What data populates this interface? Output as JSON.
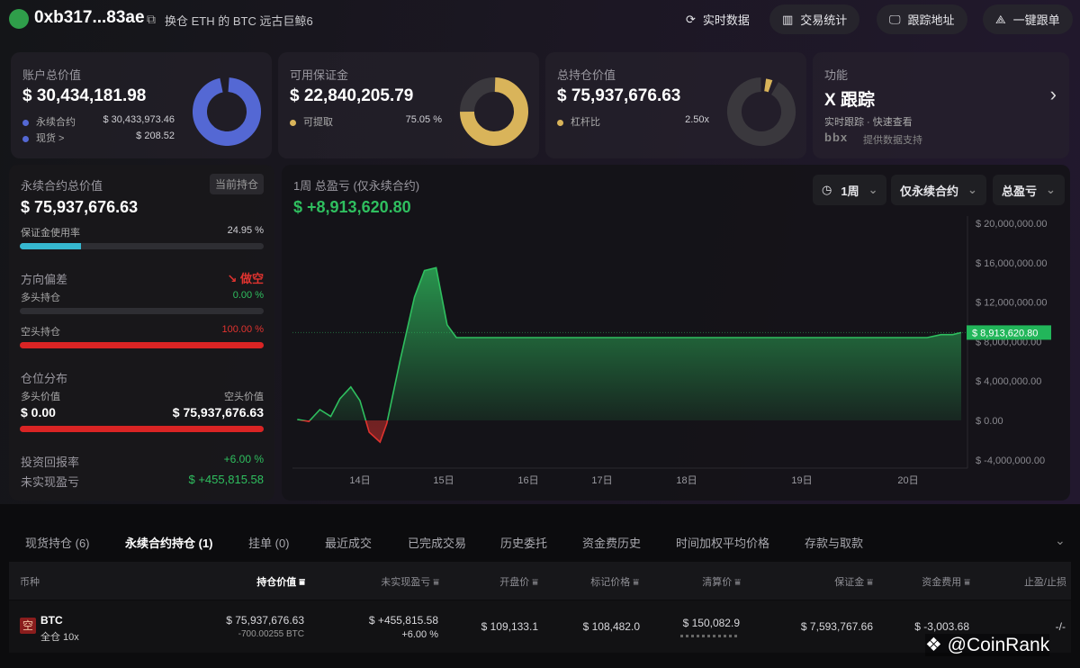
{
  "header": {
    "address": "0xb317...83ae",
    "label": "换仓 ETH 的 BTC 远古巨鲸6",
    "buttons": [
      "实时数据",
      "交易统计",
      "跟踪地址",
      "一键跟单"
    ]
  },
  "cards": {
    "account": {
      "title": "账户总价值",
      "value": "$ 30,434,181.98",
      "rows": [
        {
          "label": "永续合约",
          "value": "$ 30,433,973.46"
        },
        {
          "label": "现货 >",
          "value": "$ 208.52"
        }
      ],
      "color": "#5468d4"
    },
    "margin": {
      "title": "可用保证金",
      "value": "$ 22,840,205.79",
      "row_label": "可提取",
      "row_value": "75.05 %",
      "percent": 75.05,
      "color": "#d9b45a"
    },
    "position": {
      "title": "总持仓价值",
      "value": "$ 75,937,676.63",
      "row_label": "杠杆比",
      "row_value": "2.50x",
      "color": "#d9b45a"
    },
    "feature": {
      "title": "功能",
      "name": "X 跟踪",
      "desc": "实时跟踪 · 快速查看",
      "brand": "bbx",
      "support": "提供数据支持"
    }
  },
  "perp": {
    "title": "永续合约总价值",
    "badge": "当前持仓",
    "value": "$ 75,937,676.63",
    "margin_label": "保证金使用率",
    "margin_value": "24.95 %",
    "margin_percent": 24.95,
    "direction_label": "方向偏差",
    "direction_value": "做空",
    "long_label": "多头持仓",
    "long_value": "0.00 %",
    "short_label": "空头持仓",
    "short_value": "100.00 %",
    "dist_label": "仓位分布",
    "long_val_label": "多头价值",
    "short_val_label": "空头价值",
    "long_val": "$ 0.00",
    "short_val": "$ 75,937,676.63",
    "roi_label": "投资回报率",
    "roi_value": "+6.00 %",
    "upnl_label": "未实现盈亏",
    "upnl_value": "$ +455,815.58"
  },
  "chart": {
    "title": "1周 总盈亏 (仅永续合约)",
    "value": "$ +8,913,620.80",
    "filters": [
      "1周",
      "仅永续合约",
      "总盈亏"
    ],
    "current_label": "$ 8,913,620.80"
  },
  "chart_data": {
    "type": "area",
    "ylim": [
      -4000000,
      20000000
    ],
    "yticks": [
      "$ 20,000,000.00",
      "$ 16,000,000.00",
      "$ 12,000,000.00",
      "$ 8,000,000.00",
      "$ 4,000,000.00",
      "$ 0.00",
      "$ -4,000,000.00"
    ],
    "xticks": [
      "14日",
      "15日",
      "16日",
      "17日",
      "18日",
      "19日",
      "20日"
    ],
    "points": [
      [
        13.25,
        100000
      ],
      [
        13.39,
        -100000
      ],
      [
        13.52,
        1100000
      ],
      [
        13.65,
        400000
      ],
      [
        13.76,
        2200000
      ],
      [
        13.89,
        3400000
      ],
      [
        14.0,
        2000000
      ],
      [
        14.11,
        -1200000
      ],
      [
        14.24,
        -2200000
      ],
      [
        14.32,
        -300000
      ],
      [
        14.48,
        6100000
      ],
      [
        14.65,
        12500000
      ],
      [
        14.77,
        15200000
      ],
      [
        14.91,
        15500000
      ],
      [
        15.04,
        9700000
      ],
      [
        15.15,
        8400000
      ],
      [
        16,
        8400000
      ],
      [
        17,
        8400000
      ],
      [
        18,
        8400000
      ],
      [
        19,
        8400000
      ],
      [
        20.18,
        8400000
      ],
      [
        20.31,
        8700000
      ],
      [
        20.42,
        8700000
      ],
      [
        20.5,
        8913620.8
      ]
    ],
    "colors": {
      "positive": "#2fbf5f",
      "negative": "#e0332f"
    }
  },
  "tabs": [
    "现货持仓 (6)",
    "永续合约持仓 (1)",
    "挂单 (0)",
    "最近成交",
    "已完成交易",
    "历史委托",
    "资金费历史",
    "时间加权平均价格",
    "存款与取款"
  ],
  "table": {
    "headers": [
      "币种",
      "持仓价值",
      "未实现盈亏",
      "开盘价",
      "标记价格",
      "清算价",
      "保证金",
      "资金费用",
      "止盈/止损"
    ],
    "rows": [
      {
        "side": "空",
        "coin": "BTC",
        "mode": "全仓 10x",
        "value": "$ 75,937,676.63",
        "size": "-700.00255 BTC",
        "upnl": "$ +455,815.58",
        "upnl_pct": "+6.00 %",
        "entry": "$ 109,133.1",
        "mark": "$ 108,482.0",
        "liq": "$ 150,082.9",
        "margin": "$ 7,593,767.66",
        "funding": "$ -3,003.68",
        "tpsl": "-/-"
      }
    ]
  },
  "watermark": "@CoinRank"
}
